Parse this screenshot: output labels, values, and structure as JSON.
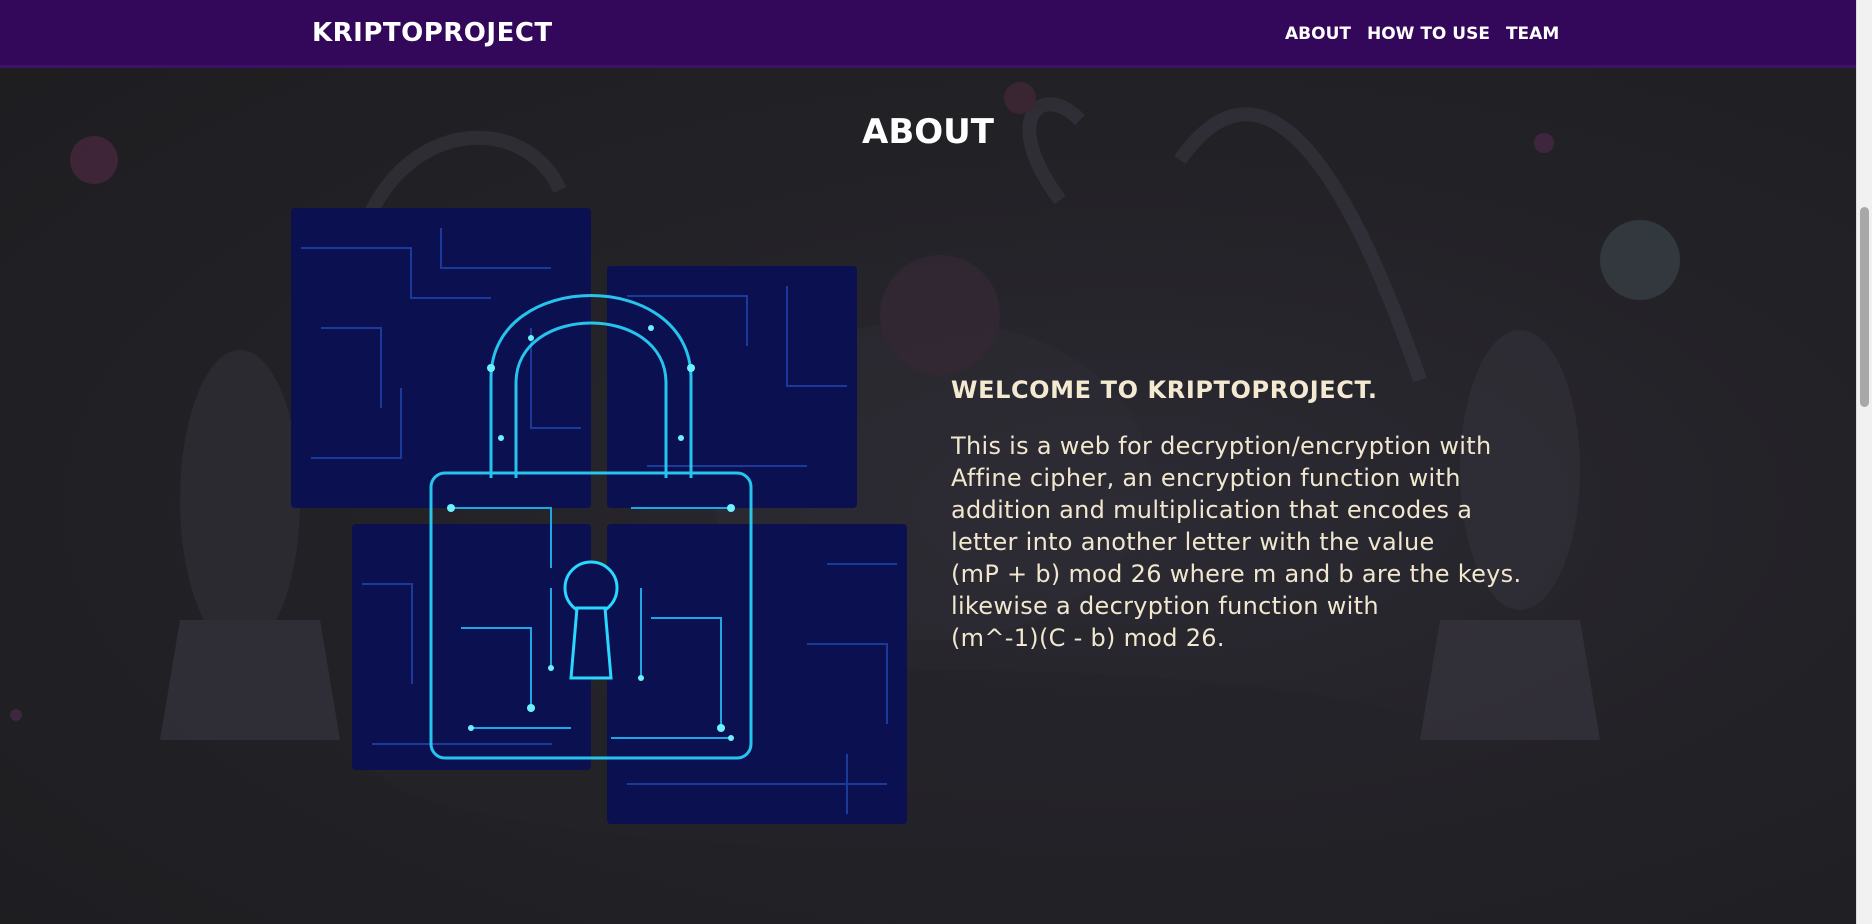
{
  "navbar": {
    "brand": "KRIPTOPROJECT",
    "links": [
      "ABOUT",
      "HOW TO USE",
      "TEAM"
    ]
  },
  "about": {
    "heading": "ABOUT",
    "welcome": "WELCOME TO KRIPTOPROJECT.",
    "description_lines": [
      "This is a web for decryption/encryption with",
      "Affine cipher, an encryption function with",
      "addition and multiplication that encodes a",
      "letter into another letter with the value",
      "(mP + b) mod 26 where m and b are the keys.",
      "likewise a decryption function with",
      "(m^-1)(C - b) mod 26."
    ]
  },
  "colors": {
    "navbar": "#33075a",
    "background": "#1f1f22",
    "text_cream": "#f1e7cf",
    "tile_blue": "#0b1050",
    "circuit_cyan": "#2ad7ff"
  },
  "images": {
    "lock_tiles": "circuit-lock-icon"
  }
}
